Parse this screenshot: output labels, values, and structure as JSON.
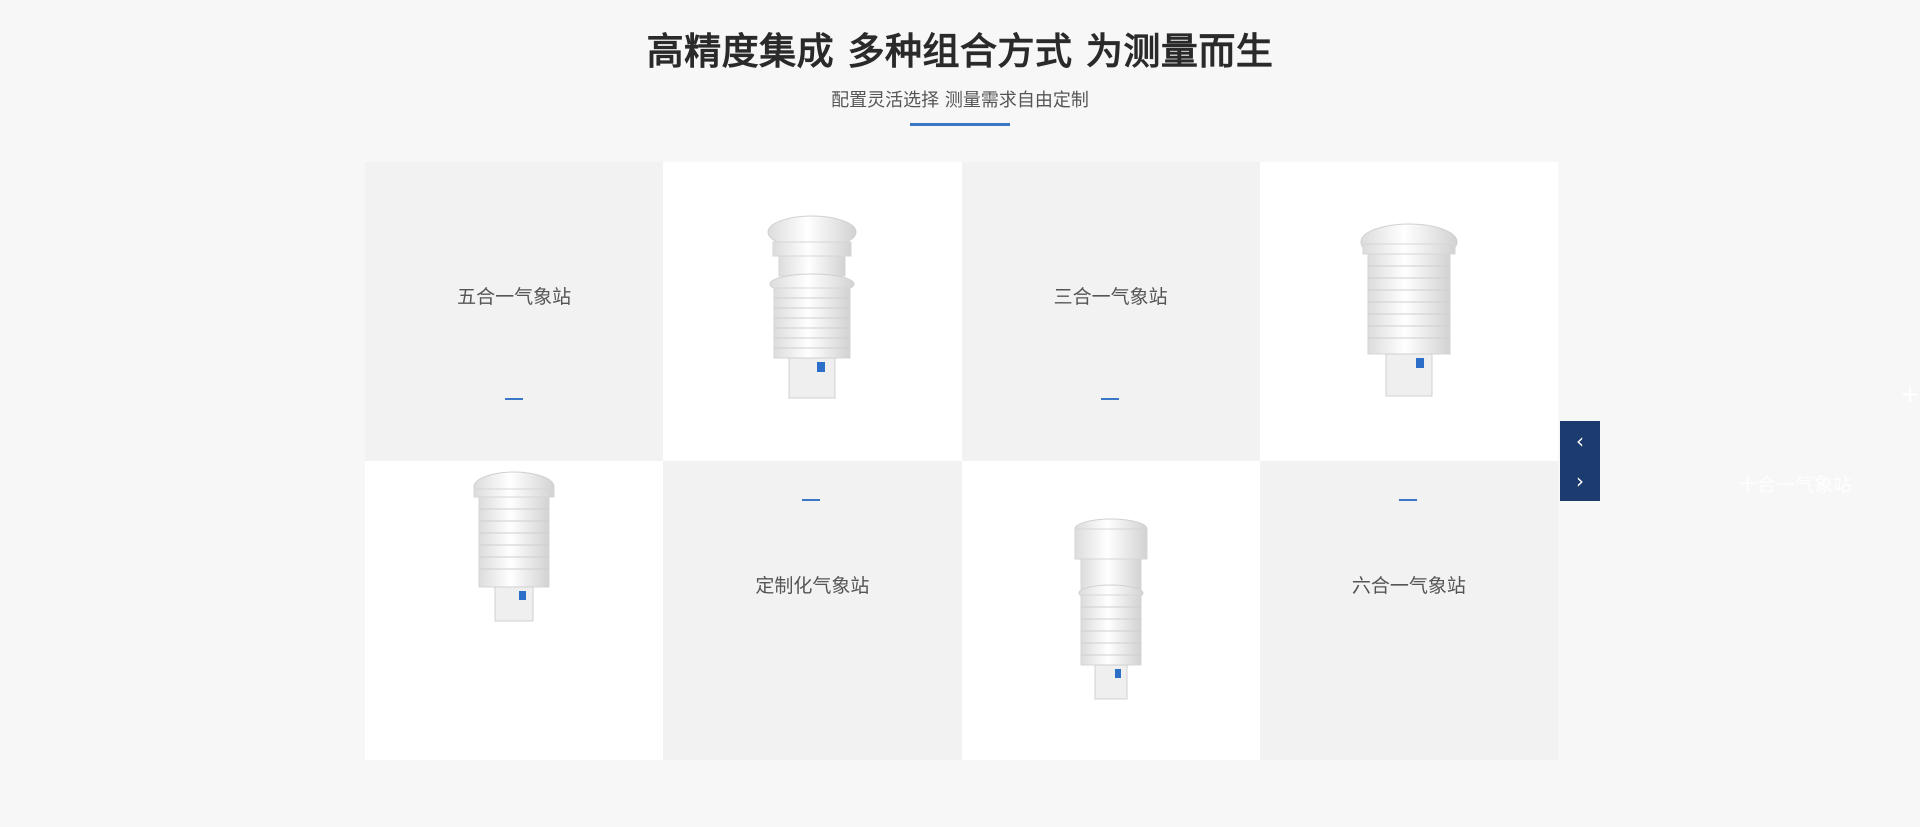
{
  "header": {
    "title": "高精度集成 多种组合方式 为测量而生",
    "subtitle": "配置灵活选择 测量需求自由定制",
    "accent_color": "#3a78c6"
  },
  "grid": {
    "cells": [
      {
        "type": "text",
        "label": "五合一气象站"
      },
      {
        "type": "image",
        "product": "weather-sensor-icon"
      },
      {
        "type": "text",
        "label": "三合一气象站"
      },
      {
        "type": "image",
        "product": "weather-sensor-icon"
      },
      {
        "type": "image",
        "product": "weather-sensor-icon"
      },
      {
        "type": "text",
        "label": "定制化气象站"
      },
      {
        "type": "image",
        "product": "weather-sensor-icon"
      },
      {
        "type": "text",
        "label": "六合一气象站"
      }
    ]
  },
  "carousel": {
    "prev_glyph": "‹",
    "next_glyph": "›",
    "ghost_label": "十合一气象站",
    "ghost_plus": "+",
    "nav_color": "#1c3b6e"
  }
}
